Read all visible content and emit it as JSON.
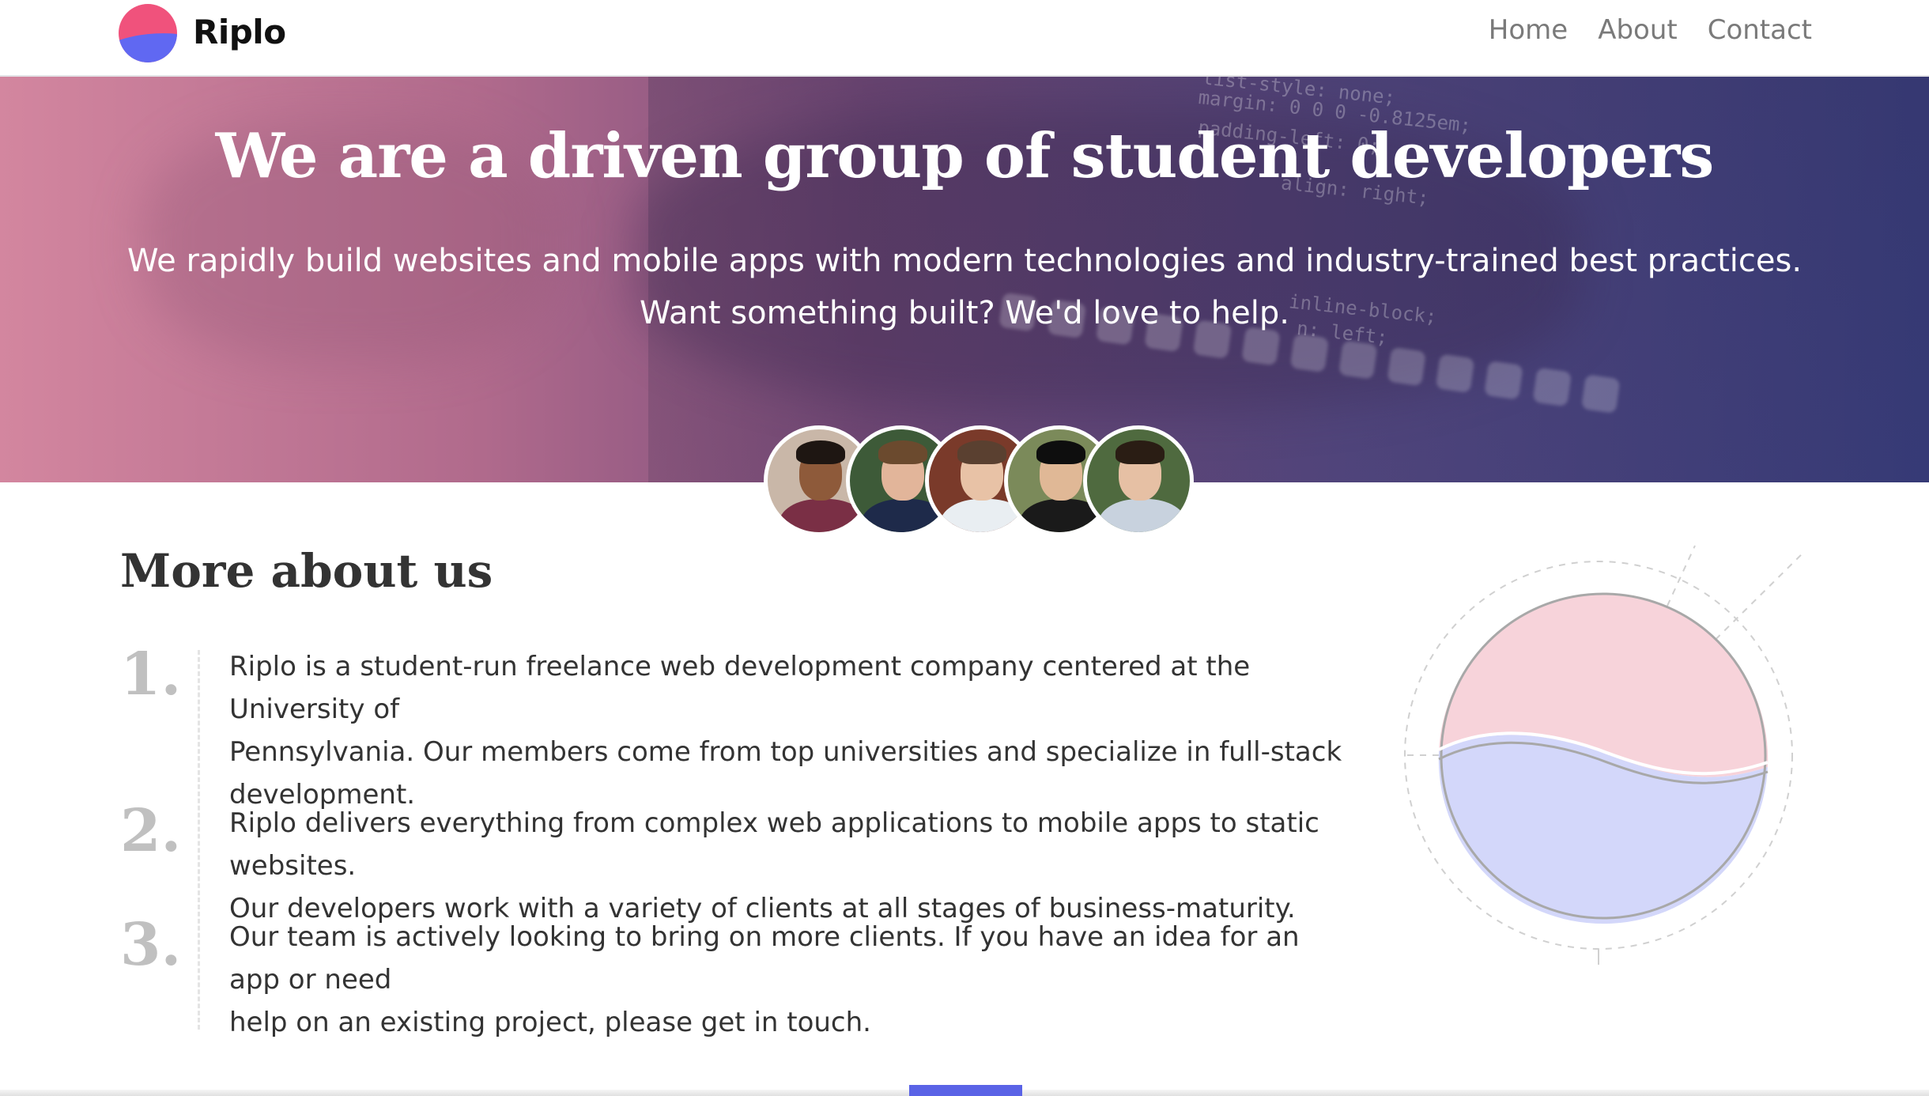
{
  "nav": {
    "brand": "Riplo",
    "links": [
      "Home",
      "About",
      "Contact"
    ]
  },
  "hero": {
    "title": "We are a driven group of student developers",
    "subtitle_line1": "We rapidly build websites and mobile apps with modern technologies and industry-trained best practices.",
    "subtitle_line2": "Want something built? We'd love to help.",
    "code_lines": [
      "list-style: none;",
      "margin: 0 0 0 -0.8125em;",
      "padding-left: 0;",
      "align: right;",
      "inline-block;",
      "n: left;"
    ]
  },
  "team": {
    "avatar_count": 5
  },
  "about": {
    "title": "More about us",
    "items": [
      {
        "number": "1.",
        "line1": "Riplo is a student-run freelance web development company centered at the University of",
        "line2": "Pennsylvania. Our members come from top universities and specialize in full-stack",
        "line3": "development."
      },
      {
        "number": "2.",
        "line1": "Riplo delivers everything from complex web applications to mobile apps to static websites.",
        "line2": "Our developers work with a variety of clients at all stages of business-maturity."
      },
      {
        "number": "3.",
        "line1": "Our team is actively looking to bring on more clients. If you have an idea for an app or need",
        "line2": "help on an existing project, please get in touch."
      }
    ]
  },
  "colors": {
    "brand_pink": "#f0527c",
    "brand_blue": "#6068f2",
    "illus_pink": "#f7d3da",
    "illus_blue": "#d3d7fa"
  }
}
